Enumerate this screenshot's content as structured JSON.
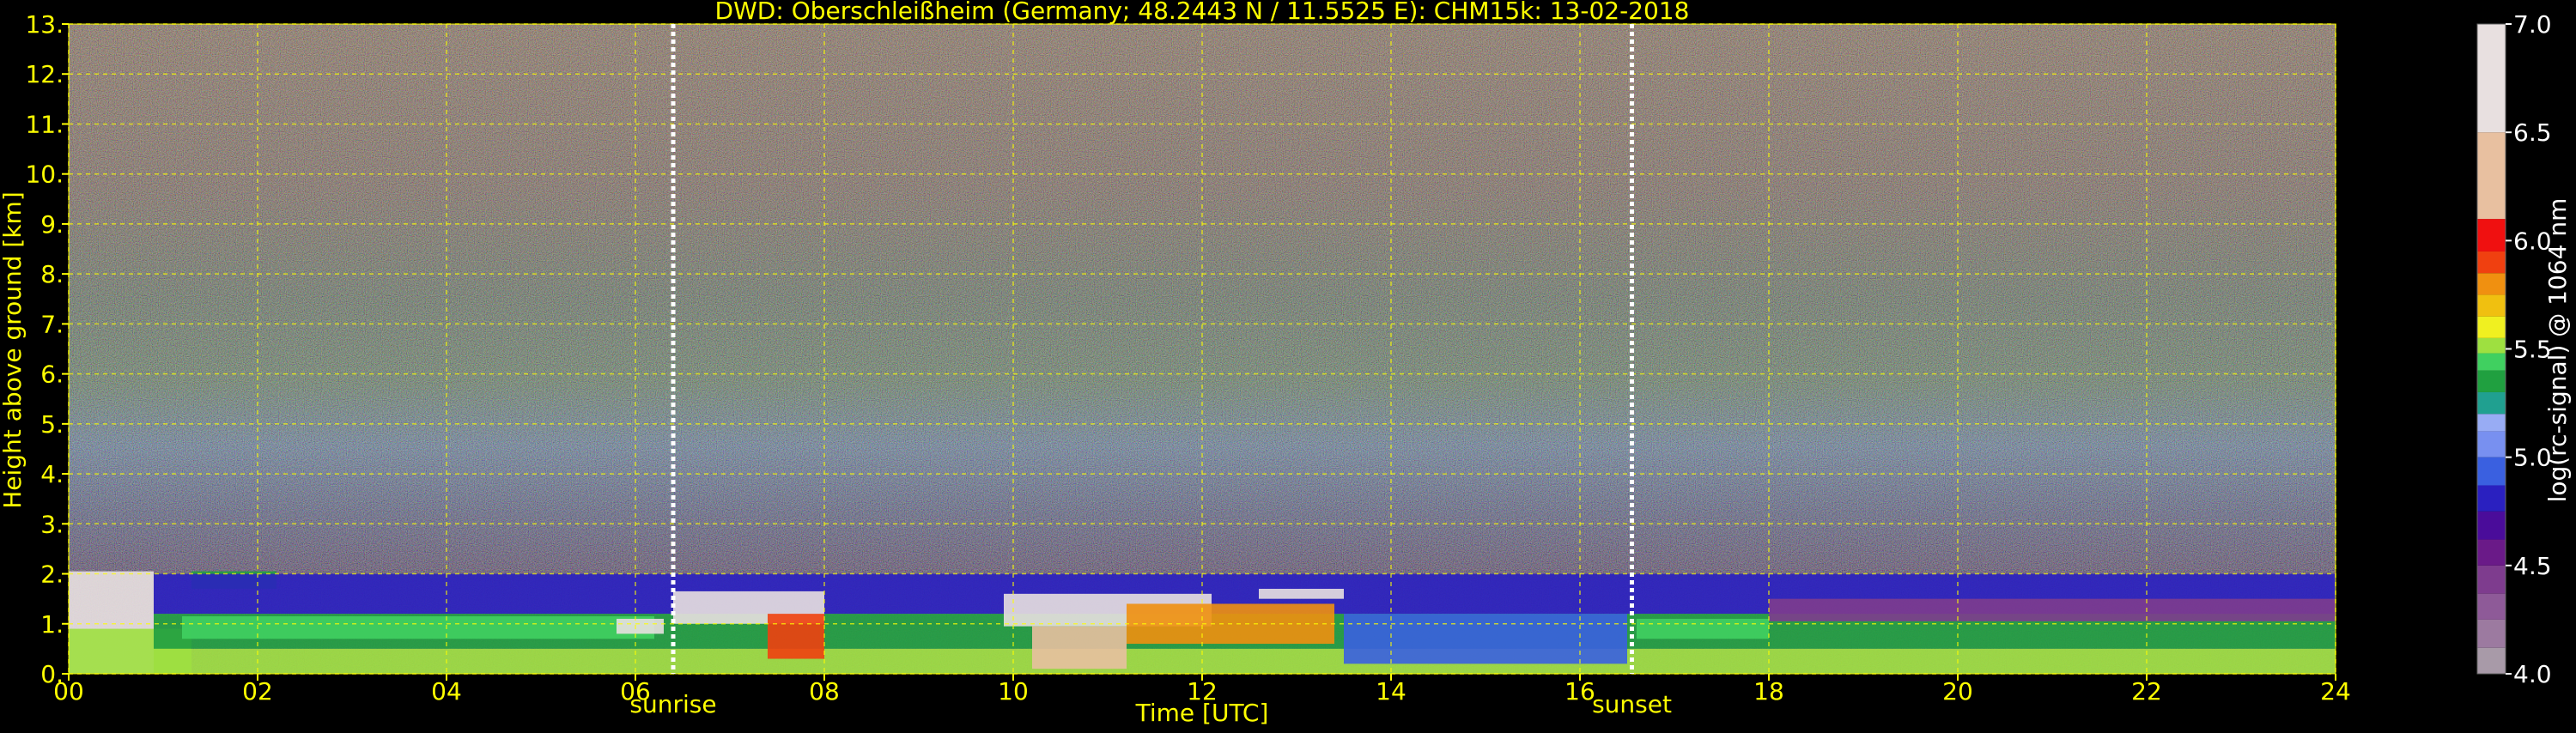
{
  "colors": {
    "background": "#000000",
    "text": "#ffff00",
    "cbar_text": "#ffffff",
    "grid": "#ffff00",
    "sun_marker": "#ffffff"
  },
  "chart_data": {
    "type": "heatmap",
    "title": "DWD: Oberschleißheim (Germany; 48.2443 N / 11.5525 E):    CHM15k: 13-02-2018",
    "xlabel": "Time [UTC]",
    "ylabel": "Height above ground [km]",
    "xlim": [
      0,
      24
    ],
    "ylim": [
      0,
      13
    ],
    "x_ticks": [
      0,
      2,
      4,
      6,
      8,
      10,
      12,
      14,
      16,
      18,
      20,
      22,
      24
    ],
    "x_tick_labels": [
      "00",
      "02",
      "04",
      "06",
      "08",
      "10",
      "12",
      "14",
      "16",
      "18",
      "20",
      "22",
      "24"
    ],
    "y_ticks": [
      0,
      1,
      2,
      3,
      4,
      5,
      6,
      7,
      8,
      9,
      10,
      11,
      12,
      13
    ],
    "y_tick_labels": [
      "0.",
      "1.",
      "2.",
      "3.",
      "4.",
      "5.",
      "6.",
      "7.",
      "8.",
      "9.",
      "10.",
      "11.",
      "12.",
      "13."
    ],
    "grid": true,
    "sunrise": {
      "time": 6.4,
      "label": "sunrise"
    },
    "sunset": {
      "time": 16.55,
      "label": "sunset"
    },
    "colorbar": {
      "label": "log(rc-signal) @ 1064 nm",
      "range": [
        4.0,
        7.0
      ],
      "ticks": [
        4.0,
        4.5,
        5.0,
        5.5,
        6.0,
        6.5,
        7.0
      ],
      "tick_labels": [
        "4.0",
        "4.5",
        "5.0",
        "5.5",
        "6.0",
        "6.5",
        "7.0"
      ],
      "stops": [
        {
          "v": 4.0,
          "c": "#a89aa8"
        },
        {
          "v": 4.12,
          "c": "#9c7aa0"
        },
        {
          "v": 4.25,
          "c": "#8e5a98"
        },
        {
          "v": 4.37,
          "c": "#7e3c8e"
        },
        {
          "v": 4.5,
          "c": "#6a1a88"
        },
        {
          "v": 4.62,
          "c": "#4a0c9a"
        },
        {
          "v": 4.75,
          "c": "#2a20c0"
        },
        {
          "v": 4.87,
          "c": "#3a60e0"
        },
        {
          "v": 5.0,
          "c": "#7890f0"
        },
        {
          "v": 5.12,
          "c": "#98acf4"
        },
        {
          "v": 5.2,
          "c": "#20a090"
        },
        {
          "v": 5.3,
          "c": "#20a040"
        },
        {
          "v": 5.4,
          "c": "#40d060"
        },
        {
          "v": 5.48,
          "c": "#9ee040"
        },
        {
          "v": 5.55,
          "c": "#f0f020"
        },
        {
          "v": 5.65,
          "c": "#f0c010"
        },
        {
          "v": 5.75,
          "c": "#f09010"
        },
        {
          "v": 5.85,
          "c": "#f04010"
        },
        {
          "v": 5.95,
          "c": "#f01010"
        },
        {
          "v": 6.1,
          "c": "#e8c0a0"
        },
        {
          "v": 6.5,
          "c": "#e8e0e0"
        },
        {
          "v": 7.0,
          "c": "#ffffff"
        }
      ]
    },
    "bands": [
      {
        "t": [
          0.0,
          0.9
        ],
        "h": [
          0.0,
          2.05
        ],
        "v": 6.9
      },
      {
        "t": [
          0.0,
          1.3
        ],
        "h": [
          0.0,
          0.9
        ],
        "v": 5.5
      },
      {
        "t": [
          1.3,
          2.2
        ],
        "h": [
          1.7,
          2.05
        ],
        "v": 5.3
      },
      {
        "t": [
          0.9,
          24.0
        ],
        "h": [
          1.2,
          2.0
        ],
        "v": 4.8
      },
      {
        "t": [
          0.9,
          24.0
        ],
        "h": [
          0.5,
          1.2
        ],
        "v": 5.3
      },
      {
        "t": [
          0.9,
          24.0
        ],
        "h": [
          0.0,
          0.5
        ],
        "v": 5.5
      },
      {
        "t": [
          1.2,
          6.2
        ],
        "h": [
          0.7,
          1.15
        ],
        "v": 5.4
      },
      {
        "t": [
          5.8,
          6.3
        ],
        "h": [
          0.8,
          1.1
        ],
        "v": 6.6
      },
      {
        "t": [
          6.4,
          8.0
        ],
        "h": [
          1.0,
          1.65
        ],
        "v": 6.9
      },
      {
        "t": [
          7.4,
          8.0
        ],
        "h": [
          0.3,
          1.2
        ],
        "v": 5.85
      },
      {
        "t": [
          9.9,
          12.1
        ],
        "h": [
          0.95,
          1.6
        ],
        "v": 6.9
      },
      {
        "t": [
          10.2,
          11.2
        ],
        "h": [
          0.1,
          0.95
        ],
        "v": 6.3
      },
      {
        "t": [
          11.2,
          13.4
        ],
        "h": [
          0.6,
          1.4
        ],
        "v": 5.8
      },
      {
        "t": [
          12.6,
          13.5
        ],
        "h": [
          1.5,
          1.7
        ],
        "v": 6.8
      },
      {
        "t": [
          13.5,
          16.5
        ],
        "h": [
          0.2,
          1.2
        ],
        "v": 4.95
      },
      {
        "t": [
          16.6,
          18.0
        ],
        "h": [
          0.7,
          1.1
        ],
        "v": 5.4
      },
      {
        "t": [
          18.0,
          24.0
        ],
        "h": [
          1.05,
          1.5
        ],
        "v": 4.45
      }
    ]
  }
}
